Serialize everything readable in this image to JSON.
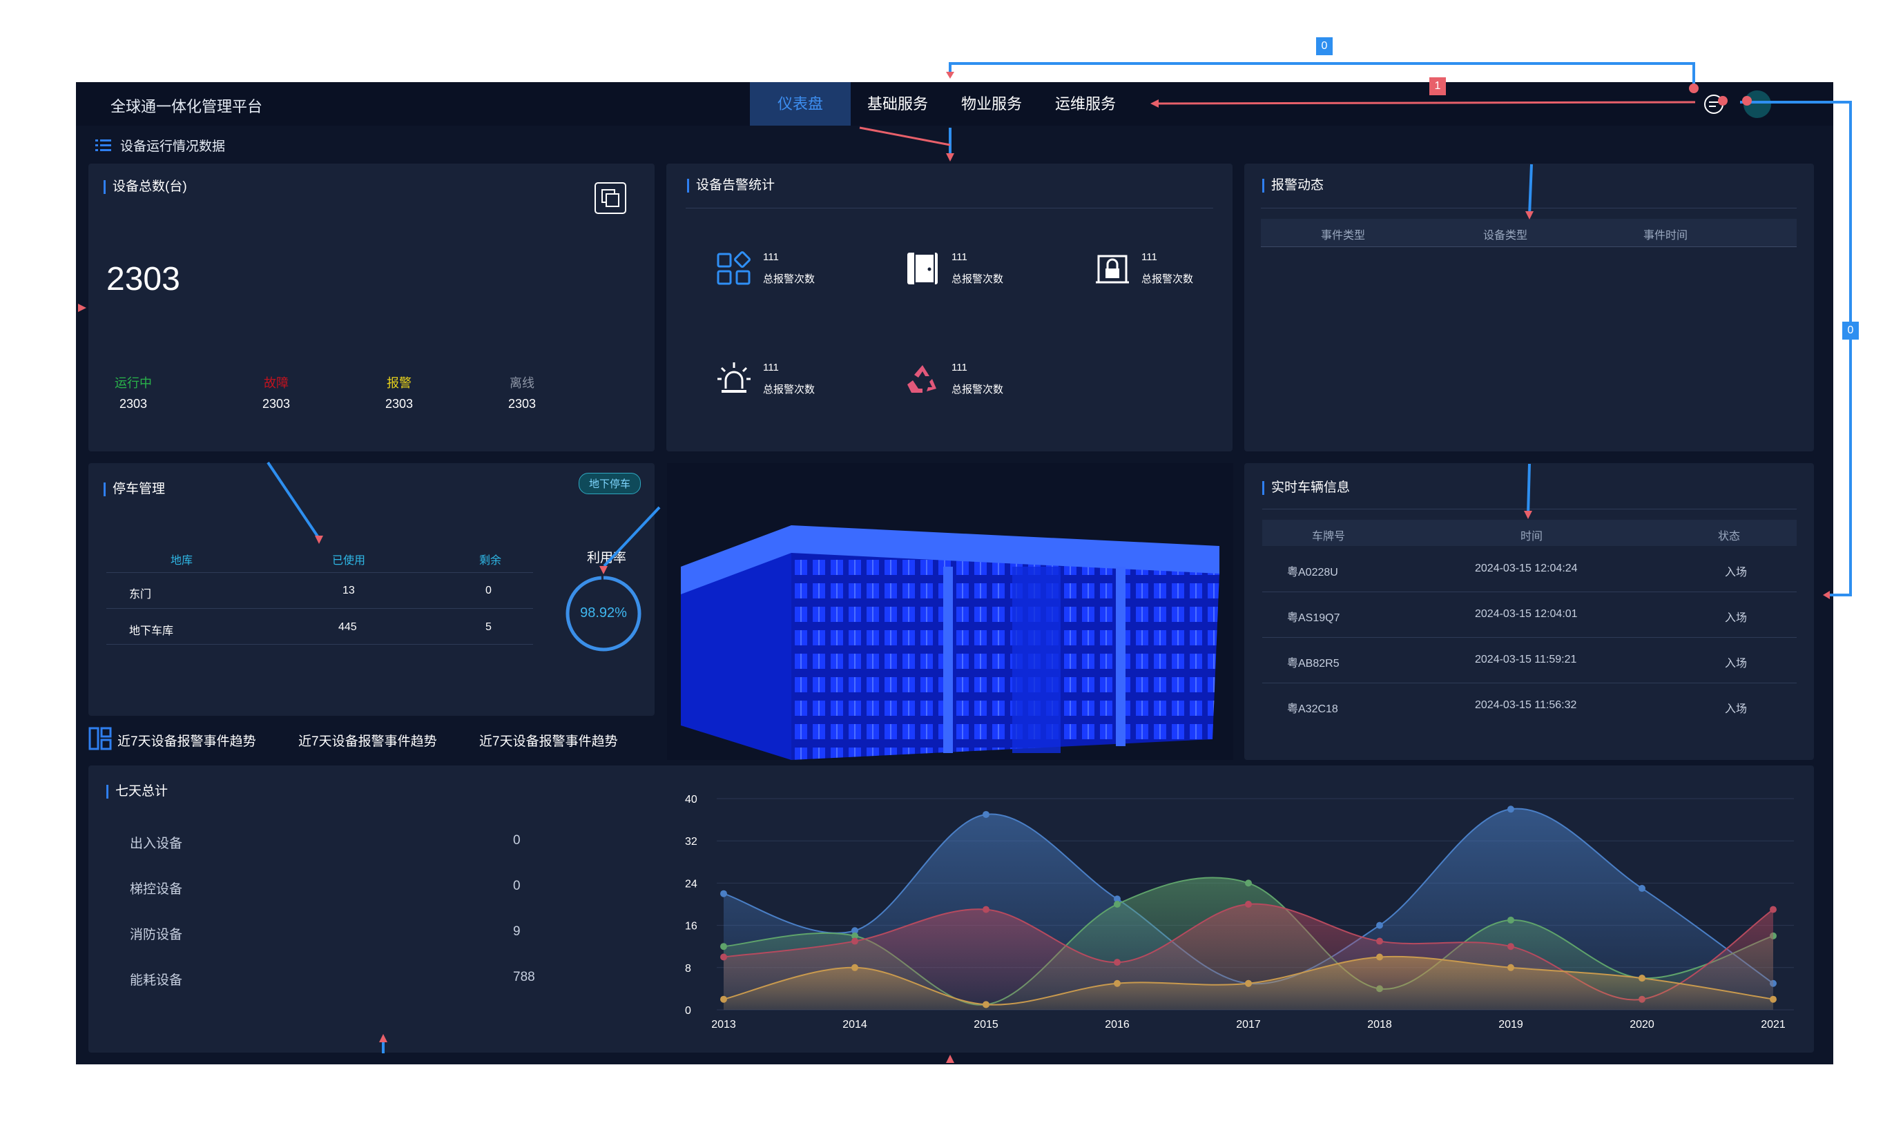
{
  "header": {
    "title": "全球通一体化管理平台",
    "nav": [
      "仪表盘",
      "基础服务",
      "物业服务",
      "运维服务"
    ],
    "active_index": 0
  },
  "device_section": {
    "title": "设备运行情况数据"
  },
  "device_total": {
    "title": "设备总数(台)",
    "value": "2303",
    "stats": [
      {
        "label": "运行中",
        "value": "2303",
        "color": "#29b34a"
      },
      {
        "label": "故障",
        "value": "2303",
        "color": "#c0131f"
      },
      {
        "label": "报警",
        "value": "2303",
        "color": "#e8d21b"
      },
      {
        "label": "离线",
        "value": "2303",
        "color": "#8e96a6"
      }
    ]
  },
  "alarm_stats": {
    "title": "设备告警统计",
    "items": [
      {
        "icon": "apps-grid-icon",
        "count": "111",
        "label": "总报警次数"
      },
      {
        "icon": "door-icon",
        "count": "111",
        "label": "总报警次数"
      },
      {
        "icon": "lock-icon",
        "count": "111",
        "label": "总报警次数"
      },
      {
        "icon": "siren-icon",
        "count": "111",
        "label": "总报警次数"
      },
      {
        "icon": "recycle-icon",
        "count": "111",
        "label": "总报警次数"
      }
    ]
  },
  "alarm_feed": {
    "title": "报警动态",
    "columns": [
      "事件类型",
      "设备类型",
      "事件时间"
    ]
  },
  "parking": {
    "title": "停车管理",
    "tag": "地下停车",
    "columns": [
      "地库",
      "已使用",
      "剩余"
    ],
    "rows": [
      [
        "东门",
        "13",
        "0"
      ],
      [
        "地下车库",
        "445",
        "5"
      ]
    ],
    "rate_label": "利用率",
    "rate_value": "98.92%",
    "rate_fraction": 0.9892
  },
  "vehicles": {
    "title": "实时车辆信息",
    "columns": [
      "车牌号",
      "时间",
      "状态"
    ],
    "rows": [
      [
        "粤A0228U",
        "2024-03-15 12:04:24",
        "入场"
      ],
      [
        "粤AS19Q7",
        "2024-03-15 12:04:01",
        "入场"
      ],
      [
        "粤AB82R5",
        "2024-03-15 11:59:21",
        "入场"
      ],
      [
        "粤A32C18",
        "2024-03-15 11:56:32",
        "入场"
      ]
    ]
  },
  "trend_tabs": [
    "近7天设备报警事件趋势",
    "近7天设备报警事件趋势",
    "近7天设备报警事件趋势"
  ],
  "summary": {
    "title": "七天总计",
    "items": [
      {
        "label": "出入设备",
        "value": "0"
      },
      {
        "label": "梯控设备",
        "value": "0"
      },
      {
        "label": "消防设备",
        "value": "9"
      },
      {
        "label": "能耗设备",
        "value": "788"
      }
    ]
  },
  "chart_data": {
    "type": "area",
    "categories": [
      "2013",
      "2014",
      "2015",
      "2016",
      "2017",
      "2018",
      "2019",
      "2020",
      "2021"
    ],
    "ylim": [
      0,
      40
    ],
    "yticks": [
      "0",
      "8",
      "16",
      "24",
      "32",
      "40"
    ],
    "grid": true,
    "series": [
      {
        "color": "#4a7fc6",
        "values": [
          22,
          15,
          37,
          21,
          5,
          16,
          38,
          23,
          5
        ]
      },
      {
        "color": "#5fa36b",
        "values": [
          12,
          14,
          1,
          20,
          24,
          4,
          17,
          6,
          14
        ]
      },
      {
        "color": "#b64a5e",
        "values": [
          10,
          13,
          19,
          9,
          20,
          13,
          12,
          2,
          19
        ]
      },
      {
        "color": "#c99a4e",
        "values": [
          2,
          8,
          1,
          5,
          5,
          10,
          8,
          6,
          2
        ]
      }
    ]
  },
  "annotations": {
    "badge_blue": "0",
    "badge_red": "1",
    "badge_side": "0"
  }
}
